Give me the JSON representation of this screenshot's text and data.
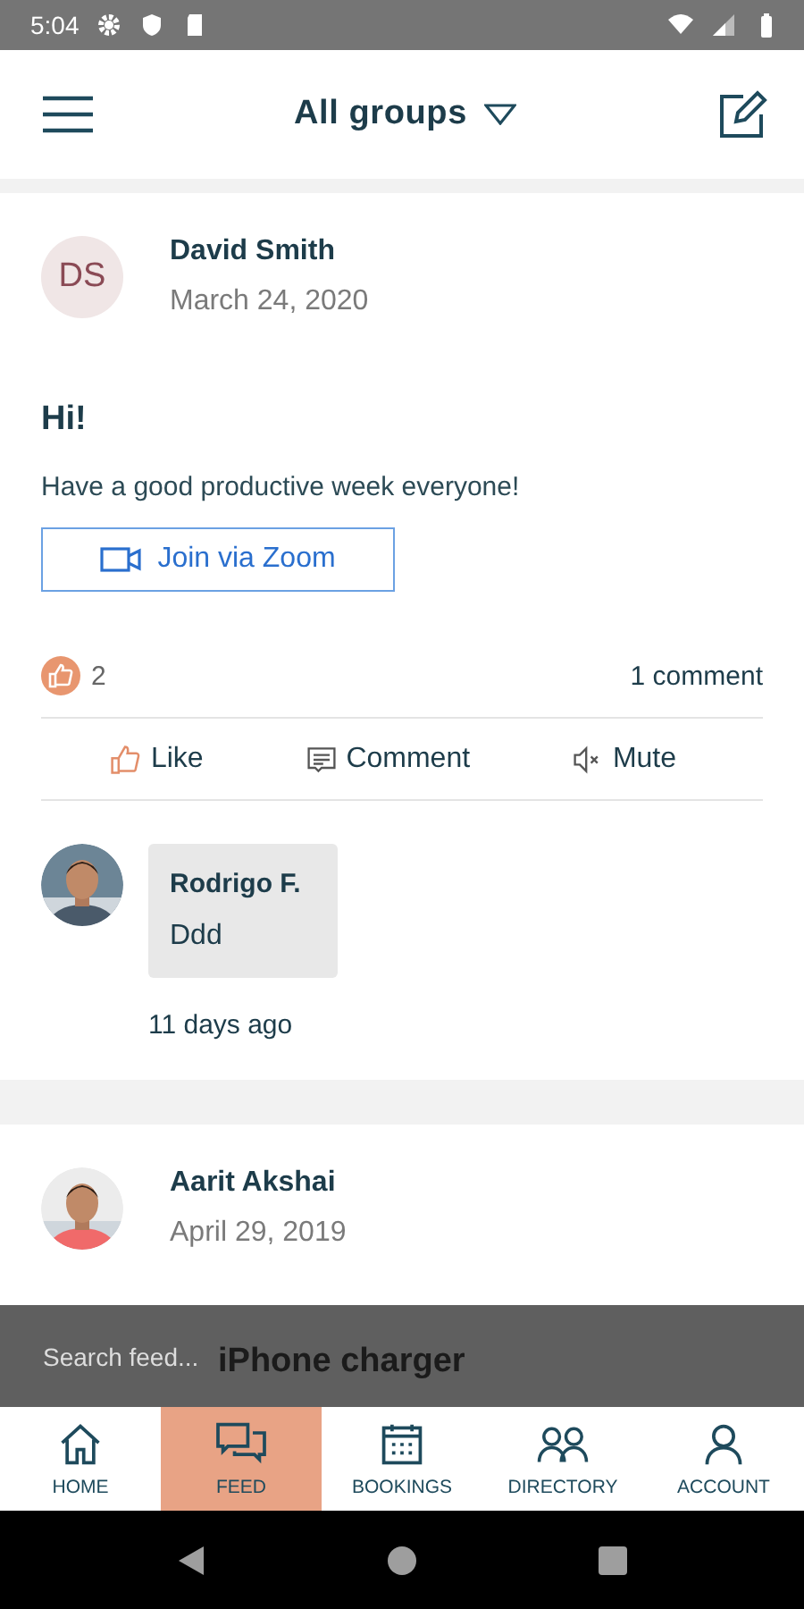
{
  "status_bar": {
    "time": "5:04"
  },
  "header": {
    "title": "All groups"
  },
  "posts": [
    {
      "avatar": {
        "kind": "initials",
        "initials": "DS"
      },
      "author": "David Smith",
      "date": "March 24, 2020",
      "title": "Hi!",
      "body": "Have a good productive week everyone!",
      "button": "Join via Zoom",
      "likes": "2",
      "comment_count": "1 comment",
      "actions": [
        {
          "kind": "like",
          "label": "Like"
        },
        {
          "kind": "comment",
          "label": "Comment"
        },
        {
          "kind": "mute",
          "label": "Mute"
        }
      ],
      "comments": [
        {
          "author": "Rodrigo F.",
          "text": "Ddd",
          "time": "11 days ago"
        }
      ]
    },
    {
      "author": "Aarit Akshai",
      "date": "April 29, 2019",
      "title": "iPhone charger"
    }
  ],
  "search": {
    "placeholder": "Search feed..."
  },
  "nav": [
    {
      "kind": "home",
      "label": "HOME",
      "selected": false
    },
    {
      "kind": "feed",
      "label": "FEED",
      "selected": true
    },
    {
      "kind": "bookings",
      "label": "BOOKINGS",
      "selected": false
    },
    {
      "kind": "directory",
      "label": "DIRECTORY",
      "selected": false
    },
    {
      "kind": "account",
      "label": "ACCOUNT",
      "selected": false
    }
  ]
}
